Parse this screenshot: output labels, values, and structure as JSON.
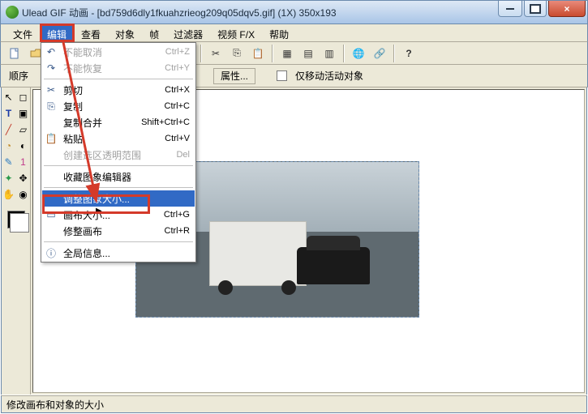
{
  "title": "Ulead GIF 动画 - [bd759d6dly1fkuahzrieog209q05dqv5.gif] (1X) 350x193",
  "menubar": [
    "文件",
    "编辑",
    "查看",
    "对象",
    "帧",
    "过滤器",
    "视频 F/X",
    "帮助"
  ],
  "menubar_open_index": 1,
  "toolbar2": {
    "seq_label": "顺序",
    "props_label": "属性...",
    "chk_label": "仅移动活动对象"
  },
  "dropdown": {
    "items": [
      {
        "icon": "↶",
        "label": "不能取消",
        "shortcut": "Ctrl+Z",
        "disabled": true
      },
      {
        "icon": "↷",
        "label": "不能恢复",
        "shortcut": "Ctrl+Y",
        "disabled": true
      },
      {
        "sep": true
      },
      {
        "icon": "✂",
        "label": "剪切",
        "shortcut": "Ctrl+X"
      },
      {
        "icon": "⎘",
        "label": "复制",
        "shortcut": "Ctrl+C"
      },
      {
        "icon": "",
        "label": "复制合并",
        "shortcut": "Shift+Ctrl+C"
      },
      {
        "icon": "📋",
        "label": "粘贴",
        "shortcut": "Ctrl+V"
      },
      {
        "icon": "",
        "label": "创建选区透明范围",
        "shortcut": "Del",
        "disabled": true
      },
      {
        "sep": true
      },
      {
        "icon": "",
        "label": "收藏图象编辑器",
        "submenu": true
      },
      {
        "sep": true
      },
      {
        "icon": "",
        "label": "调整图象大小...",
        "highlight": true
      },
      {
        "icon": "▭",
        "label": "画布大小...",
        "shortcut": "Ctrl+G"
      },
      {
        "icon": "",
        "label": "修整画布",
        "shortcut": "Ctrl+R"
      },
      {
        "sep": true
      },
      {
        "icon": "ⓘ",
        "label": "全局信息..."
      }
    ]
  },
  "statusbar": "修改画布和对象的大小"
}
